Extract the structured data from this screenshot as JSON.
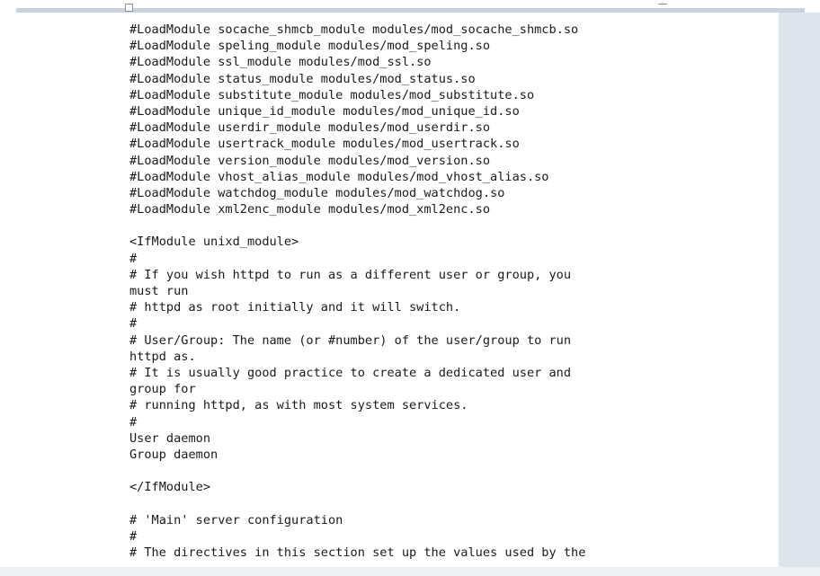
{
  "editor": {
    "lines": [
      "#LoadModule socache_shmcb_module modules/mod_socache_shmcb.so",
      "#LoadModule speling_module modules/mod_speling.so",
      "#LoadModule ssl_module modules/mod_ssl.so",
      "#LoadModule status_module modules/mod_status.so",
      "#LoadModule substitute_module modules/mod_substitute.so",
      "#LoadModule unique_id_module modules/mod_unique_id.so",
      "#LoadModule userdir_module modules/mod_userdir.so",
      "#LoadModule usertrack_module modules/mod_usertrack.so",
      "#LoadModule version_module modules/mod_version.so",
      "#LoadModule vhost_alias_module modules/mod_vhost_alias.so",
      "#LoadModule watchdog_module modules/mod_watchdog.so",
      "#LoadModule xml2enc_module modules/mod_xml2enc.so",
      "",
      "<IfModule unixd_module>",
      "#",
      "# If you wish httpd to run as a different user or group, you",
      "must run",
      "# httpd as root initially and it will switch.",
      "#",
      "# User/Group: The name (or #number) of the user/group to run",
      "httpd as.",
      "# It is usually good practice to create a dedicated user and",
      "group for",
      "# running httpd, as with most system services.",
      "#",
      "User daemon",
      "Group daemon",
      "",
      "</IfModule>",
      "",
      "# 'Main' server configuration",
      "#",
      "# The directives in this section set up the values used by the"
    ]
  }
}
